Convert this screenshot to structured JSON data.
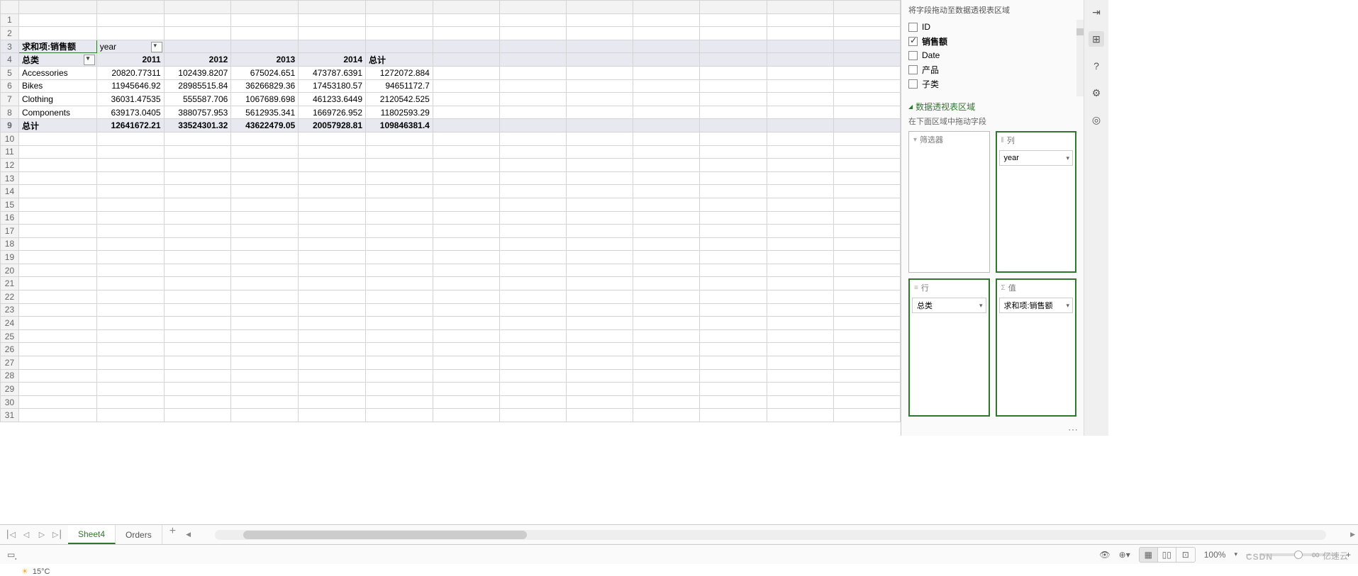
{
  "pivot": {
    "corner_label": "求和项:销售额",
    "col_field_label": "year",
    "row_field_header": "总类",
    "grand_total_col": "总计",
    "grand_total_row": "总计",
    "years": [
      "2011",
      "2012",
      "2013",
      "2014"
    ],
    "rows": [
      {
        "cat": "Accessories",
        "v": [
          "20820.77311",
          "102439.8207",
          "675024.651",
          "473787.6391"
        ],
        "total": "1272072.884"
      },
      {
        "cat": "Bikes",
        "v": [
          "11945646.92",
          "28985515.84",
          "36266829.36",
          "17453180.57"
        ],
        "total": "94651172.7"
      },
      {
        "cat": "Clothing",
        "v": [
          "36031.47535",
          "555587.706",
          "1067689.698",
          "461233.6449"
        ],
        "total": "2120542.525"
      },
      {
        "cat": "Components",
        "v": [
          "639173.0405",
          "3880757.953",
          "5612935.341",
          "1669726.952"
        ],
        "total": "11802593.29"
      }
    ],
    "totals": [
      "12641672.21",
      "33524301.32",
      "43622479.05",
      "20057928.81"
    ],
    "grand_total": "109846381.4"
  },
  "field_panel": {
    "hint": "将字段拖动至数据透视表区域",
    "fields": [
      {
        "name": "ID",
        "checked": false
      },
      {
        "name": "销售额",
        "checked": true
      },
      {
        "name": "Date",
        "checked": false
      },
      {
        "name": "产品",
        "checked": false
      },
      {
        "name": "子类",
        "checked": false
      }
    ],
    "section_title": "数据透视表区域",
    "subhint": "在下面区域中拖动字段",
    "areas": {
      "filter": {
        "label": "筛选器",
        "items": []
      },
      "columns": {
        "label": "列",
        "items": [
          "year"
        ]
      },
      "rows": {
        "label": "行",
        "items": [
          "总类"
        ]
      },
      "values": {
        "label": "值",
        "items": [
          "求和项:销售额"
        ]
      }
    }
  },
  "tabs": {
    "items": [
      "Sheet4",
      "Orders"
    ],
    "active": "Sheet4"
  },
  "status": {
    "zoom": "100%"
  },
  "watermarks": {
    "csdn": "CSDN",
    "yisu": "亿速云"
  },
  "os": {
    "weather_temp": "15°C"
  },
  "row_numbers": [
    "1",
    "2",
    "3",
    "4",
    "5",
    "6",
    "7",
    "8",
    "9",
    "10",
    "11",
    "12",
    "13",
    "14",
    "15",
    "16",
    "17",
    "18",
    "19",
    "20",
    "21",
    "22",
    "23",
    "24",
    "25",
    "26",
    "27",
    "28",
    "29",
    "30",
    "31"
  ]
}
